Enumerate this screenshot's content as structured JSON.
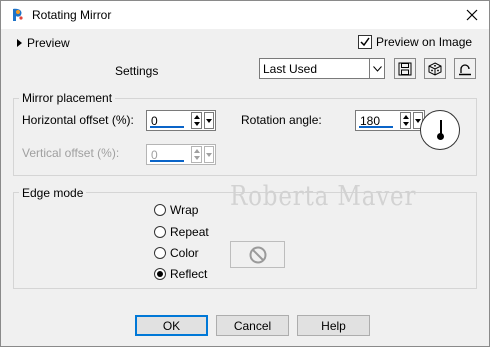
{
  "window": {
    "title": "Rotating Mirror"
  },
  "top": {
    "preview_label": "Preview",
    "preview_on_image_label": "Preview on Image",
    "preview_on_image_checked": true,
    "settings_label": "Settings",
    "preset_value": "Last Used"
  },
  "mirror": {
    "group_label": "Mirror placement",
    "horizontal_label": "Horizontal offset (%):",
    "horizontal_value": "0",
    "vertical_label": "Vertical offset (%):",
    "vertical_value": "0",
    "rotation_label": "Rotation angle:",
    "rotation_value": "180"
  },
  "edge": {
    "group_label": "Edge mode",
    "options": [
      "Wrap",
      "Repeat",
      "Color",
      "Reflect"
    ],
    "selected": "Reflect"
  },
  "watermark": "Roberta Maver",
  "buttons": {
    "ok": "OK",
    "cancel": "Cancel",
    "help": "Help"
  },
  "colors": {
    "accent": "#0a64c8",
    "window_bg": "#f0f0f0"
  }
}
